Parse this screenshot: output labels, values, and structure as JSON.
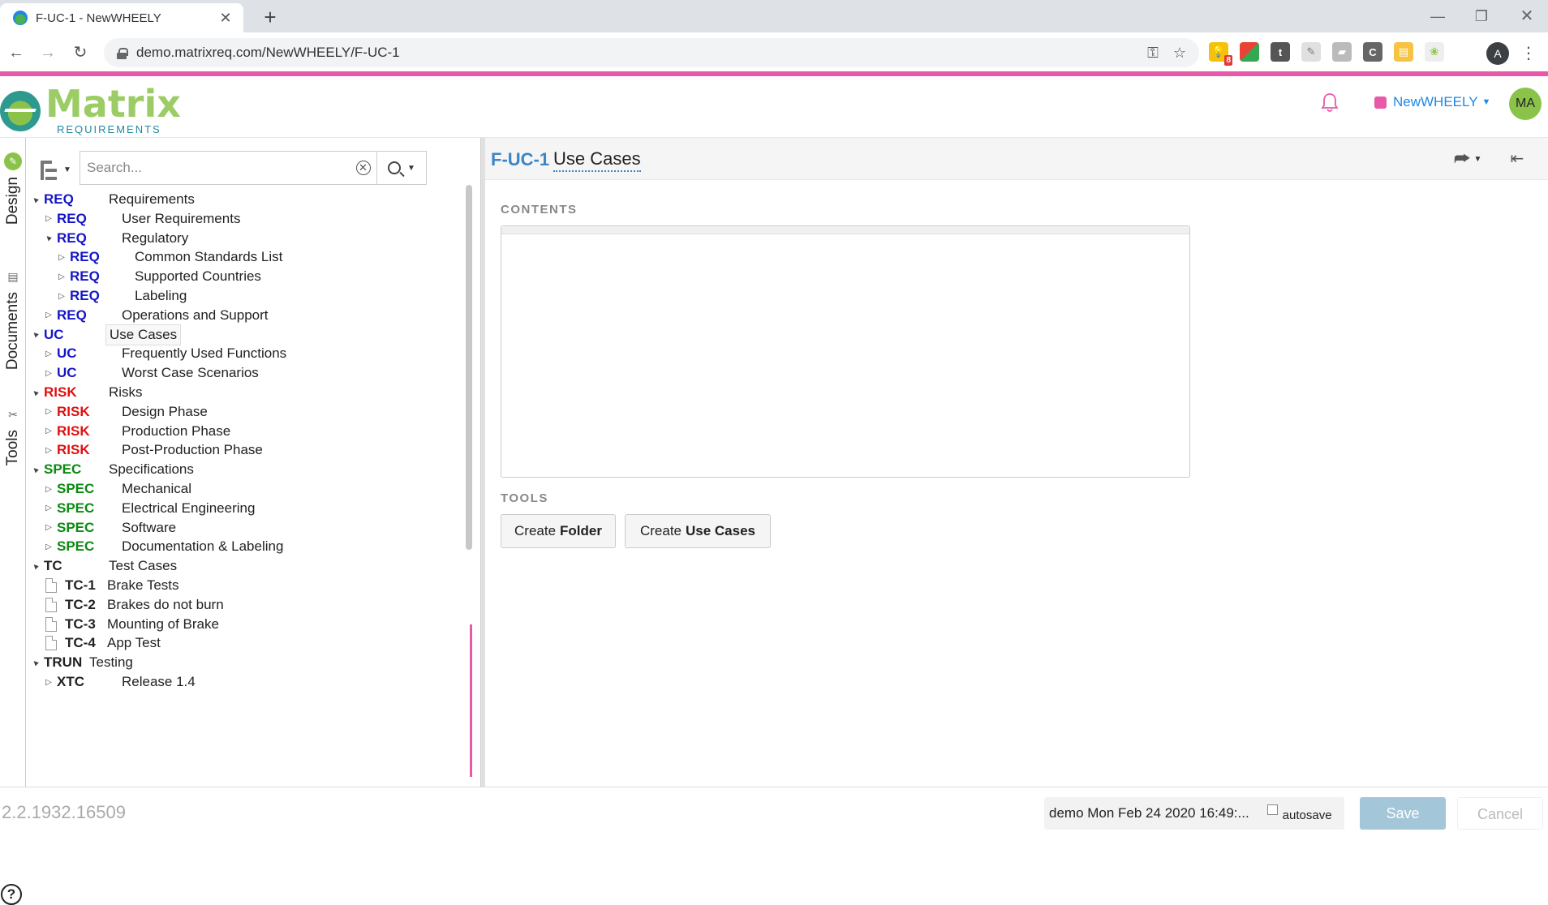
{
  "browser": {
    "tab_title": "F-UC-1 - NewWHEELY",
    "url": "demo.matrixreq.com/NewWHEELY/F-UC-1",
    "profile_initial": "A",
    "extension_badge": "8",
    "extension_letter_t": "t",
    "extension_letter_c": "C"
  },
  "header": {
    "logo_word": "Matrix",
    "logo_sub": "REQUIREMENTS",
    "project_name": "NewWHEELY",
    "user_initials": "MA",
    "project_color": "#e75aa9"
  },
  "rail": {
    "design": "Design",
    "documents": "Documents",
    "tools": "Tools",
    "help": "?"
  },
  "search": {
    "placeholder": "Search..."
  },
  "tree": [
    {
      "indent": 0,
      "twisty": "▲",
      "cat": "REQ",
      "color": "blue",
      "title": "Requirements"
    },
    {
      "indent": 1,
      "twisty": "▷",
      "cat": "REQ",
      "color": "blue",
      "title": "User Requirements"
    },
    {
      "indent": 1,
      "twisty": "▲",
      "cat": "REQ",
      "color": "blue",
      "title": "Regulatory"
    },
    {
      "indent": 2,
      "twisty": "▷",
      "cat": "REQ",
      "color": "blue",
      "title": "Common Standards List"
    },
    {
      "indent": 2,
      "twisty": "▷",
      "cat": "REQ",
      "color": "blue",
      "title": "Supported Countries"
    },
    {
      "indent": 2,
      "twisty": "▷",
      "cat": "REQ",
      "color": "blue",
      "title": "Labeling"
    },
    {
      "indent": 1,
      "twisty": "▷",
      "cat": "REQ",
      "color": "blue",
      "title": "Operations and Support"
    },
    {
      "indent": 0,
      "twisty": "▲",
      "cat": "UC",
      "color": "blue",
      "title": "Use Cases",
      "selected": true
    },
    {
      "indent": 1,
      "twisty": "▷",
      "cat": "UC",
      "color": "blue",
      "title": "Frequently Used Functions"
    },
    {
      "indent": 1,
      "twisty": "▷",
      "cat": "UC",
      "color": "blue",
      "title": "Worst Case Scenarios"
    },
    {
      "indent": 0,
      "twisty": "▲",
      "cat": "RISK",
      "color": "red",
      "title": "Risks"
    },
    {
      "indent": 1,
      "twisty": "▷",
      "cat": "RISK",
      "color": "red",
      "title": "Design Phase"
    },
    {
      "indent": 1,
      "twisty": "▷",
      "cat": "RISK",
      "color": "red",
      "title": "Production Phase"
    },
    {
      "indent": 1,
      "twisty": "▷",
      "cat": "RISK",
      "color": "red",
      "title": "Post-Production Phase"
    },
    {
      "indent": 0,
      "twisty": "▲",
      "cat": "SPEC",
      "color": "green",
      "title": "Specifications"
    },
    {
      "indent": 1,
      "twisty": "▷",
      "cat": "SPEC",
      "color": "green",
      "title": "Mechanical"
    },
    {
      "indent": 1,
      "twisty": "▷",
      "cat": "SPEC",
      "color": "green",
      "title": "Electrical Engineering"
    },
    {
      "indent": 1,
      "twisty": "▷",
      "cat": "SPEC",
      "color": "green",
      "title": "Software"
    },
    {
      "indent": 1,
      "twisty": "▷",
      "cat": "SPEC",
      "color": "green",
      "title": "Documentation & Labeling"
    },
    {
      "indent": 0,
      "twisty": "▲",
      "cat": "TC",
      "color": "black",
      "title": "Test Cases"
    },
    {
      "indent": 1,
      "doc": true,
      "tid": "TC-1",
      "title": "Brake Tests"
    },
    {
      "indent": 1,
      "doc": true,
      "tid": "TC-2",
      "title": "Brakes do not burn"
    },
    {
      "indent": 1,
      "doc": true,
      "tid": "TC-3",
      "title": "Mounting of Brake"
    },
    {
      "indent": 1,
      "doc": true,
      "tid": "TC-4",
      "title": "App Test"
    },
    {
      "indent": 0,
      "twisty": "▲",
      "cat": "TRUN",
      "color": "black",
      "title": "Testing",
      "compact": true
    },
    {
      "indent": 1,
      "twisty": "▷",
      "cat": "XTC",
      "color": "black",
      "title": "Release 1.4"
    }
  ],
  "main": {
    "item_id": "F-UC-1",
    "item_title": "Use Cases",
    "contents_label": "CONTENTS",
    "tools_label": "TOOLS",
    "create_folder_prefix": "Create",
    "create_folder_bold": "Folder",
    "create_uc_prefix": "Create",
    "create_uc_bold": "Use Cases"
  },
  "footer": {
    "version": "2.2.1932.16509",
    "status": "demo Mon Feb 24 2020 16:49:...",
    "autosave_label": "autosave",
    "save_label": "Save",
    "cancel_label": "Cancel"
  },
  "colors": {
    "accent": "#e75aa9",
    "brand_green": "#8bc34a",
    "link_blue": "#3b86c6",
    "cat_blue": "#1616c6",
    "cat_red": "#e01010",
    "cat_green": "#0a8a10"
  },
  "icons": {
    "bell": "bell-icon",
    "share": "share-icon",
    "collapse": "collapse-panel-icon",
    "search": "search-icon",
    "clear": "clear-icon",
    "filter": "tree-filter-icon"
  }
}
